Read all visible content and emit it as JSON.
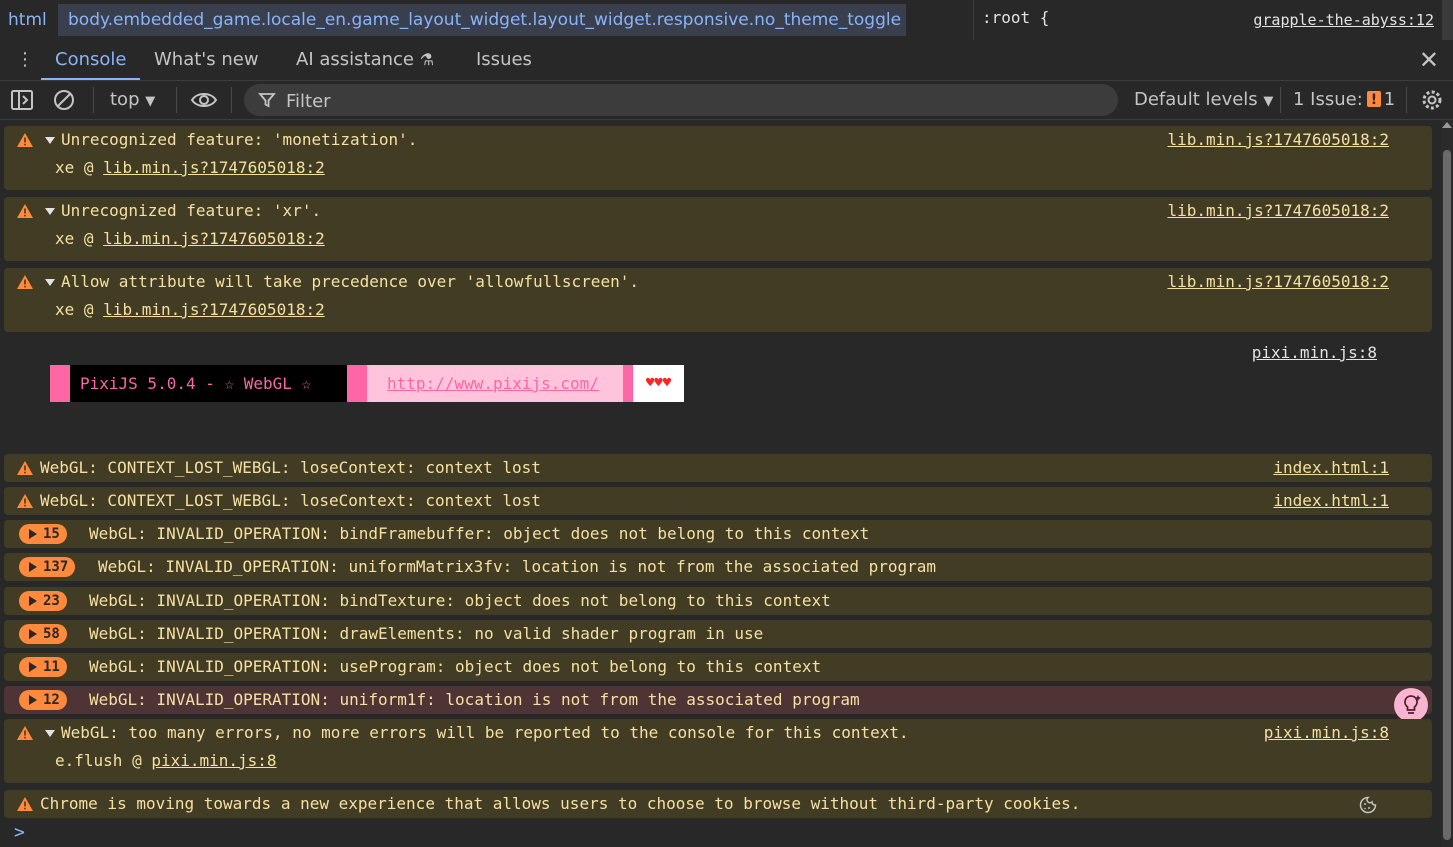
{
  "breadcrumb": {
    "html": "html",
    "body": "body.embedded_game.locale_en.game_layout_widget.layout_widget.responsive.no_theme_toggle"
  },
  "styles_pane": {
    "rule": ":root {",
    "source": "grapple-the-abyss:12"
  },
  "tabs": {
    "console": "Console",
    "whats_new": "What's new",
    "ai": "AI assistance",
    "issues": "Issues"
  },
  "toolbar": {
    "context": "top",
    "filter_placeholder": "Filter",
    "levels": "Default levels",
    "issues_label": "1 Issue:",
    "issues_count": "1"
  },
  "messages": {
    "m1": {
      "text": "Unrecognized feature: 'monetization'.",
      "source": "lib.min.js?1747605018:2",
      "frame_fn": "xe @ ",
      "frame_link": "lib.min.js?1747605018:2"
    },
    "m2": {
      "text": "Unrecognized feature: 'xr'.",
      "source": "lib.min.js?1747605018:2",
      "frame_fn": "xe @ ",
      "frame_link": "lib.min.js?1747605018:2"
    },
    "m3": {
      "text": "Allow attribute will take precedence over 'allowfullscreen'.",
      "source": "lib.min.js?1747605018:2",
      "frame_fn": "xe @ ",
      "frame_link": "lib.min.js?1747605018:2"
    },
    "pixi": {
      "source": "pixi.min.js:8",
      "banner_text": "PixiJS 5.0.4 - ☆ WebGL ☆",
      "banner_link": "http://www.pixijs.com/",
      "hearts": "♥♥♥"
    },
    "m4": {
      "text": "WebGL: CONTEXT_LOST_WEBGL: loseContext: context lost",
      "source": "index.html:1"
    },
    "m5": {
      "text": "WebGL: CONTEXT_LOST_WEBGL: loseContext: context lost",
      "source": "index.html:1"
    },
    "g1": {
      "count": "15",
      "text": "WebGL: INVALID_OPERATION: bindFramebuffer: object does not belong to this context"
    },
    "g2": {
      "count": "137",
      "text": "WebGL: INVALID_OPERATION: uniformMatrix3fv: location is not from the associated program"
    },
    "g3": {
      "count": "23",
      "text": "WebGL: INVALID_OPERATION: bindTexture: object does not belong to this context"
    },
    "g4": {
      "count": "58",
      "text": "WebGL: INVALID_OPERATION: drawElements: no valid shader program in use"
    },
    "g5": {
      "count": "11",
      "text": "WebGL: INVALID_OPERATION: useProgram: object does not belong to this context"
    },
    "g6": {
      "count": "12",
      "text": "WebGL: INVALID_OPERATION: uniform1f: location is not from the associated program"
    },
    "m6": {
      "text": "WebGL: too many errors, no more errors will be reported to the console for this context.",
      "source": "pixi.min.js:8",
      "frame_fn": "e.flush @ ",
      "frame_link": "pixi.min.js:8"
    },
    "m7": {
      "text": "Chrome is moving towards a new experience that allows users to choose to browse without third-party cookies."
    }
  },
  "prompt": ">",
  "colors": {
    "accent": "#8ab4f8",
    "warning_bg": "#413c23",
    "warning_text": "#f5e0a3",
    "error_bg": "#4e3435",
    "badge": "#ff8a3d",
    "pixi_pink": "#ff66a5"
  },
  "icons": [
    "kebab-menu-icon",
    "close-icon",
    "sidebar-toggle-icon",
    "clear-console-icon",
    "eye-icon",
    "filter-icon",
    "settings-gear-icon",
    "warning-icon",
    "expand-triangle-icon",
    "ai-assistant-icon",
    "cookie-icon"
  ]
}
